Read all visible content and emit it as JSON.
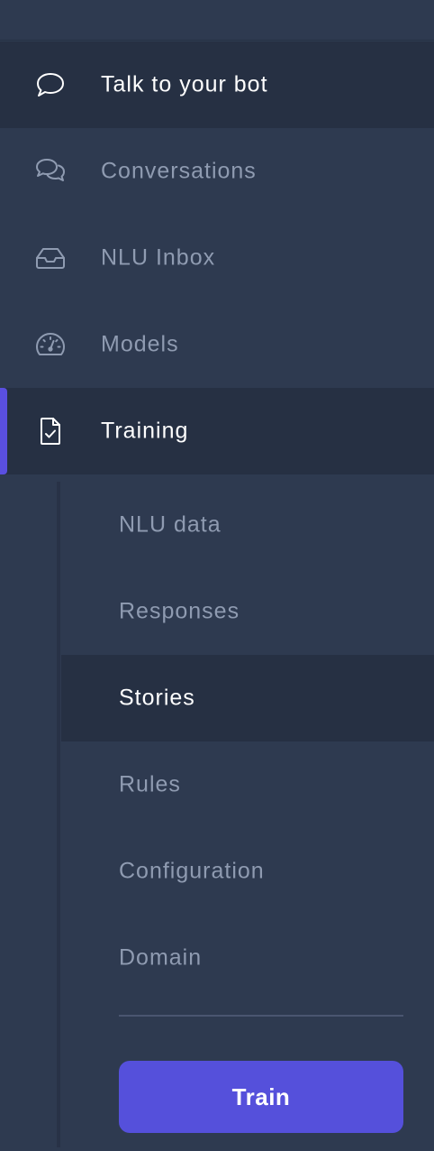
{
  "nav": {
    "items": [
      {
        "id": "talk",
        "label": "Talk to your bot",
        "icon": "chat-bubble-icon",
        "active": true
      },
      {
        "id": "conversations",
        "label": "Conversations",
        "icon": "chat-bubbles-icon",
        "active": false
      },
      {
        "id": "nlu-inbox",
        "label": "NLU Inbox",
        "icon": "inbox-icon",
        "active": false
      },
      {
        "id": "models",
        "label": "Models",
        "icon": "gauge-icon",
        "active": false
      },
      {
        "id": "training",
        "label": "Training",
        "icon": "document-check-icon",
        "active": true
      }
    ]
  },
  "training": {
    "subitems": [
      {
        "label": "NLU data",
        "active": false
      },
      {
        "label": "Responses",
        "active": false
      },
      {
        "label": "Stories",
        "active": true
      },
      {
        "label": "Rules",
        "active": false
      },
      {
        "label": "Configuration",
        "active": false
      },
      {
        "label": "Domain",
        "active": false
      }
    ],
    "train_label": "Train"
  },
  "colors": {
    "background": "#2e3a50",
    "active_background": "#263043",
    "accent": "#5550db",
    "text_active": "#ffffff",
    "text_inactive": "#8f9bb1"
  }
}
